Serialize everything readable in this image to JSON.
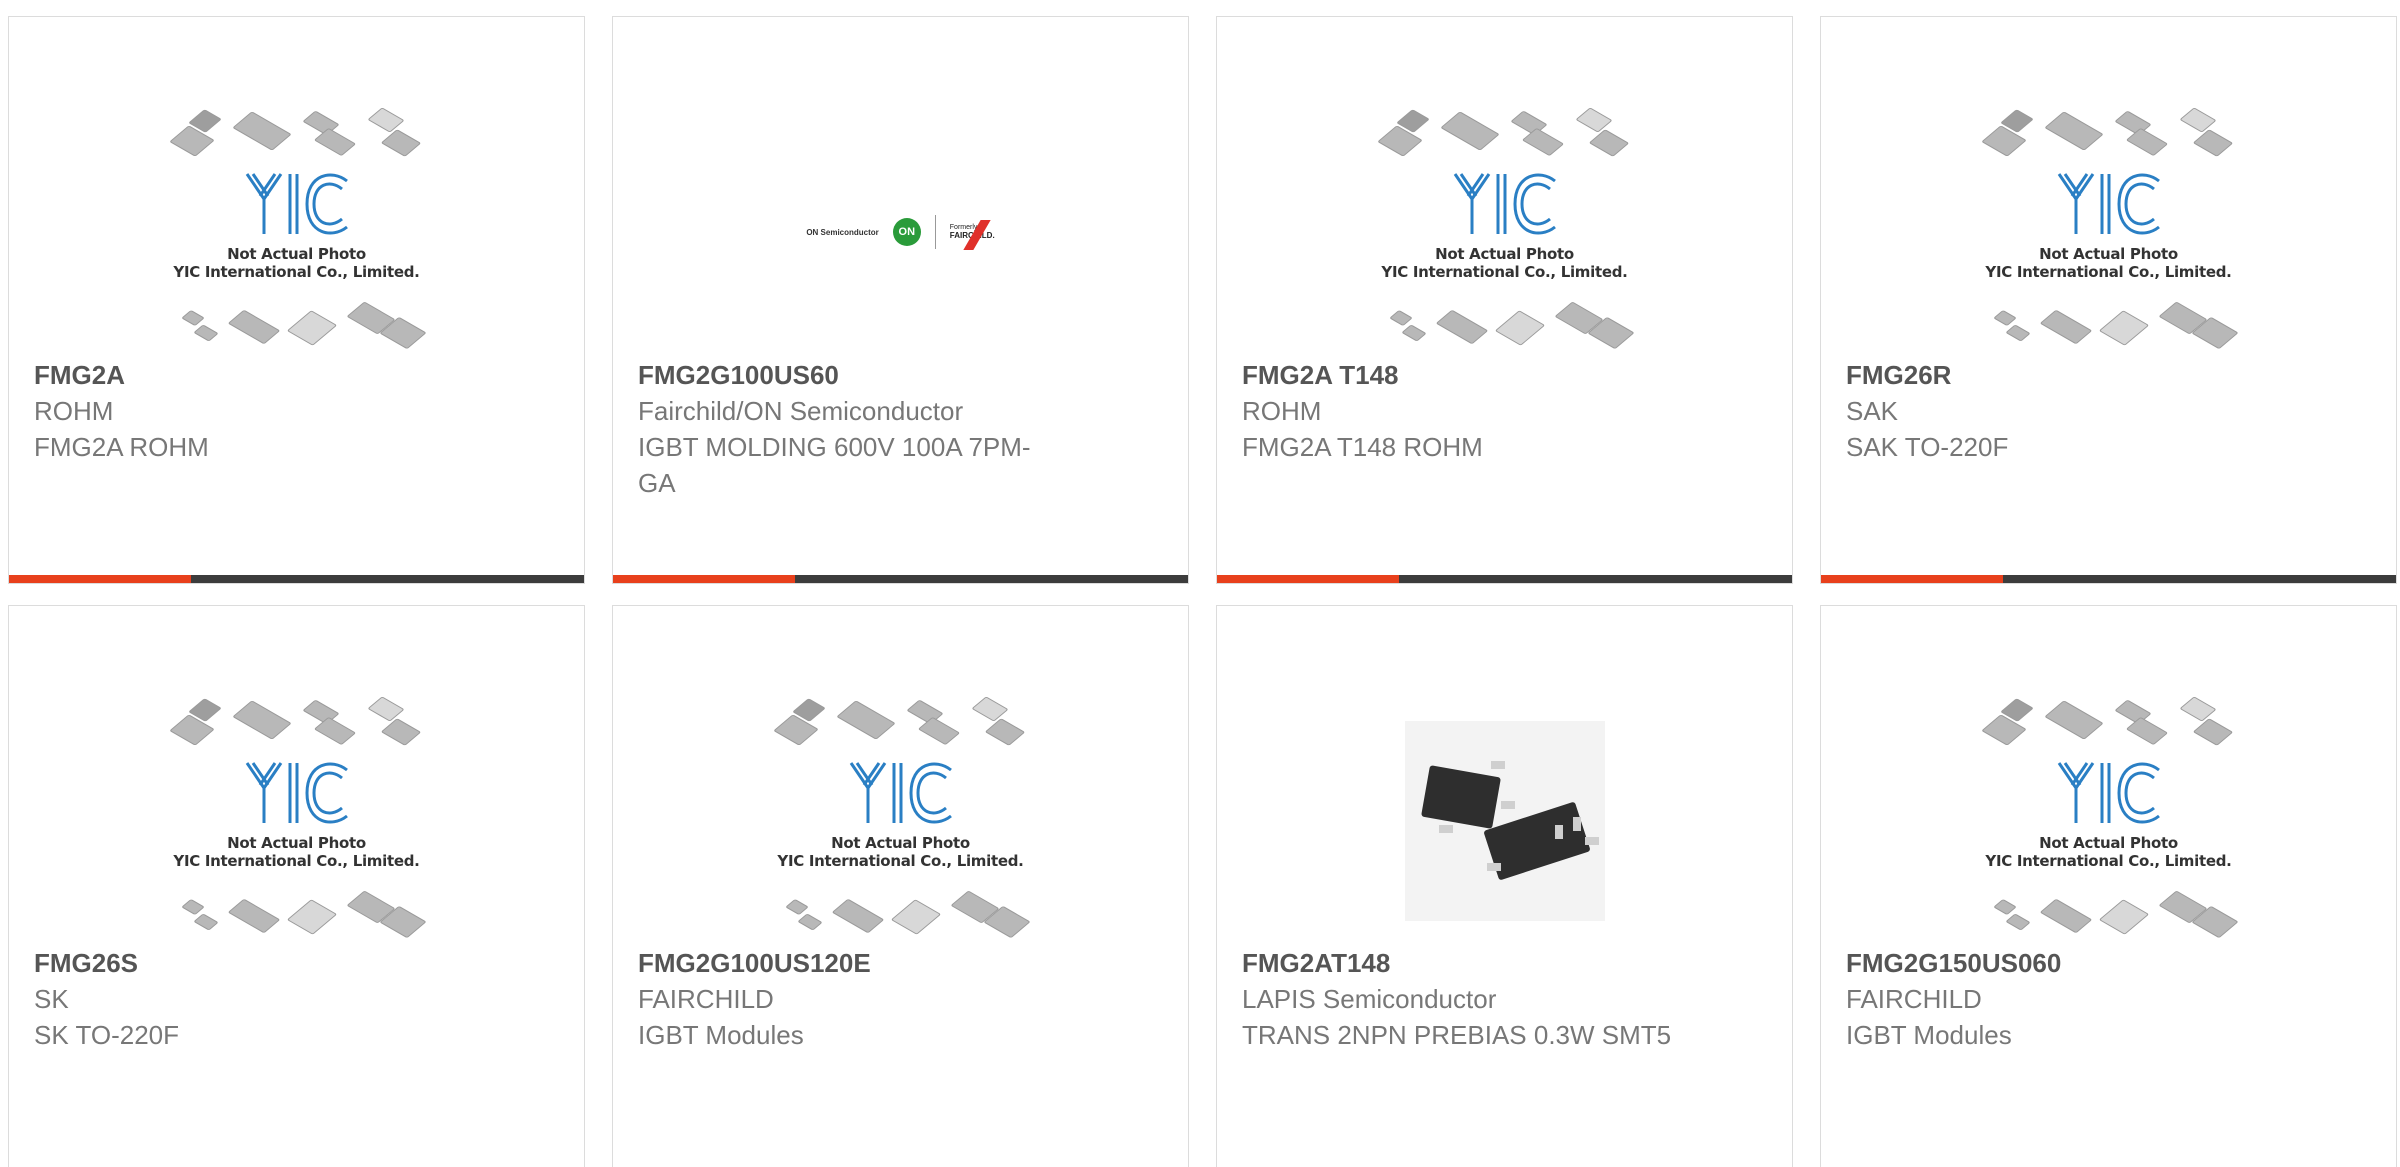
{
  "placeholder": {
    "line1": "Not Actual Photo",
    "line2": "YIC International Co., Limited.",
    "logo_text": "YIC"
  },
  "brand_logo": {
    "on_text": "ON Semiconductor",
    "on_mark": "ON",
    "fairchild_small": "Formerly",
    "fairchild_text": "FAIRCHILD."
  },
  "colors": {
    "accent": "#e8401c",
    "bar": "#3c3c3c",
    "logo_blue": "#2a7fc4"
  },
  "products": [
    {
      "part": "FMG2A",
      "manufacturer": "ROHM",
      "description": "FMG2A ROHM",
      "image": "placeholder"
    },
    {
      "part": "FMG2G100US60",
      "manufacturer": "Fairchild/ON Semiconductor",
      "description": "IGBT MOLDING 600V 100A 7PM-GA",
      "image": "brand-logo"
    },
    {
      "part": "FMG2A T148",
      "manufacturer": "ROHM",
      "description": "FMG2A T148 ROHM",
      "image": "placeholder"
    },
    {
      "part": "FMG26R",
      "manufacturer": "SAK",
      "description": "SAK TO-220F",
      "image": "placeholder"
    },
    {
      "part": "FMG26S",
      "manufacturer": "SK",
      "description": "SK TO-220F",
      "image": "placeholder"
    },
    {
      "part": "FMG2G100US120E",
      "manufacturer": "FAIRCHILD",
      "description": "IGBT Modules",
      "image": "placeholder"
    },
    {
      "part": "FMG2AT148",
      "manufacturer": "LAPIS Semiconductor",
      "description": "TRANS 2NPN PREBIAS 0.3W SMT5",
      "image": "sot-photo"
    },
    {
      "part": "FMG2G150US060",
      "manufacturer": "FAIRCHILD",
      "description": "IGBT Modules",
      "image": "placeholder"
    }
  ]
}
